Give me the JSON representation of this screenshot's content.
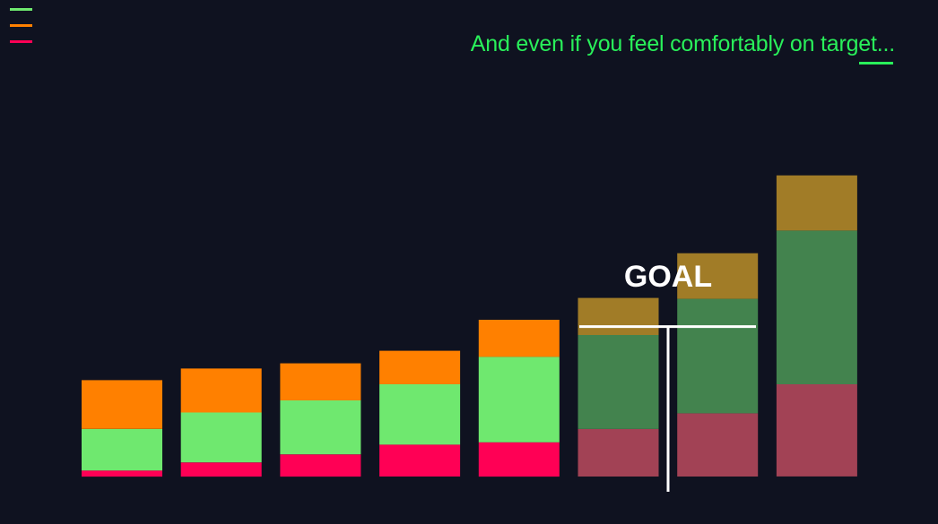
{
  "headline": {
    "text": "And even if you feel comfortably on target...",
    "color": "#29f05a"
  },
  "legend": {
    "colors": [
      "#6fe86f",
      "#ff8000",
      "#ff0055"
    ]
  },
  "goal": {
    "label": "GOAL",
    "value": 37.2,
    "color": "#ffffff"
  },
  "chart_data": {
    "type": "bar",
    "stacked": true,
    "categories": [
      "",
      "",
      "",
      "",
      "",
      "",
      "",
      ""
    ],
    "series": [
      {
        "color": "#ff0055",
        "faded_color": "#a24255",
        "values": [
          1.5,
          3.5,
          5.5,
          7.9,
          8.5,
          11.8,
          15.7,
          22.9
        ]
      },
      {
        "color": "#6fe86f",
        "faded_color": "#43834e",
        "values": [
          10.3,
          12.4,
          13.4,
          15.0,
          21.2,
          23.3,
          28.4,
          38.1
        ]
      },
      {
        "color": "#ff8000",
        "faded_color": "#a17c27",
        "values": [
          12.1,
          10.9,
          9.2,
          8.3,
          9.2,
          9.2,
          11.3,
          13.7
        ]
      }
    ],
    "faded_from_index": 5,
    "ylim": [
      0,
      80
    ],
    "grid": false,
    "legend": "top-left"
  }
}
